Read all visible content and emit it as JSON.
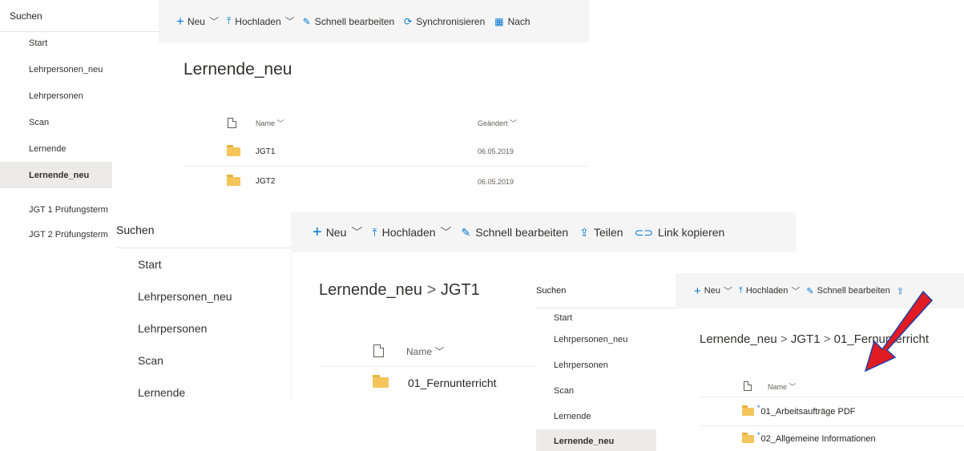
{
  "shot1": {
    "search": "Suchen",
    "nav": [
      "Start",
      "Lehrpersonen_neu",
      "Lehrpersonen",
      "Scan",
      "Lernende",
      "Lernende_neu",
      "JGT 1 Prüfungsterm",
      "JGT 2 Prüfungsterm"
    ],
    "selected_nav": "Lernende_neu",
    "commands": {
      "new": "Neu",
      "upload": "Hochladen",
      "quick_edit": "Schnell bearbeiten",
      "sync": "Synchronisieren",
      "more": "Nach"
    },
    "title": "Lernende_neu",
    "columns": {
      "name": "Name",
      "modified": "Geändert"
    },
    "rows": [
      {
        "name": "JGT1",
        "modified": "06.05.2019"
      },
      {
        "name": "JGT2",
        "modified": "06.05.2019"
      }
    ]
  },
  "shot2": {
    "search": "Suchen",
    "nav": [
      "Start",
      "Lehrpersonen_neu",
      "Lehrpersonen",
      "Scan",
      "Lernende"
    ],
    "commands": {
      "new": "Neu",
      "upload": "Hochladen",
      "quick_edit": "Schnell bearbeiten",
      "share": "Teilen",
      "copy_link": "Link kopieren"
    },
    "breadcrumb": [
      "Lernende_neu",
      "JGT1"
    ],
    "columns": {
      "name": "Name"
    },
    "rows": [
      {
        "name": "01_Fernunterricht"
      }
    ]
  },
  "shot3": {
    "search": "Suchen",
    "nav": [
      "Start",
      "Lehrpersonen_neu",
      "Lehrpersonen",
      "Scan",
      "Lernende",
      "Lernende_neu"
    ],
    "selected_nav": "Lernende_neu",
    "commands": {
      "new": "Neu",
      "upload": "Hochladen",
      "quick_edit": "Schnell bearbeiten"
    },
    "breadcrumb": [
      "Lernende_neu",
      "JGT1",
      "01_Fernunterricht"
    ],
    "columns": {
      "name": "Name"
    },
    "rows": [
      {
        "name": "01_Arbeitsaufträge PDF"
      },
      {
        "name": "02_Allgemeine Informationen"
      }
    ]
  },
  "annotation": {
    "arrow_color": "#e11b22",
    "arrow_outline": "#1f3fa8"
  },
  "colors": {
    "accent": "#0078d4",
    "folder": "#f3c55b",
    "selected_bg": "#edebe9",
    "command_bar_bg": "#f5f5f5"
  }
}
